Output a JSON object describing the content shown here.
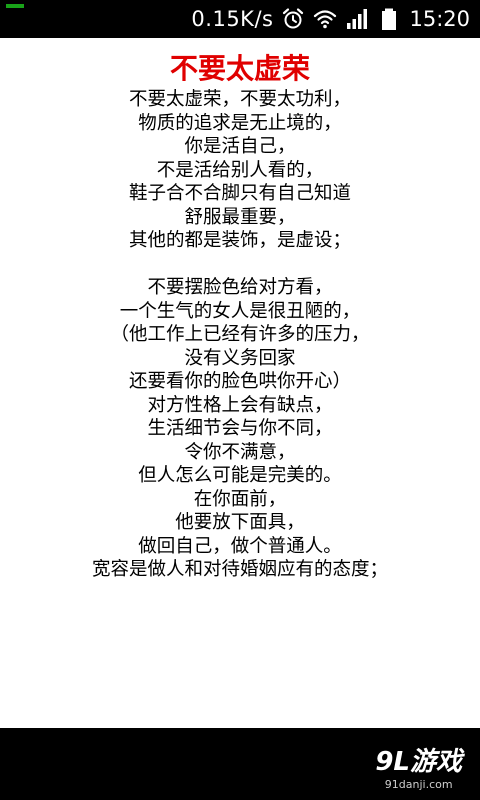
{
  "status_bar": {
    "network_speed": "0.15K/s",
    "time": "15:20",
    "icons": [
      "alarm-icon",
      "wifi-icon",
      "signal-icon",
      "battery-icon"
    ]
  },
  "article": {
    "title": "不要太虚荣",
    "lines": [
      "不要太虚荣，不要太功利，",
      "物质的追求是无止境的，",
      "你是活自己，",
      "不是活给别人看的，",
      "鞋子合不合脚只有自己知道",
      "舒服最重要，",
      "其他的都是装饰，是虚设；",
      "",
      "不要摆脸色给对方看，",
      "一个生气的女人是很丑陋的，",
      "（他工作上已经有许多的压力，",
      "没有义务回家",
      "还要看你的脸色哄你开心）",
      "对方性格上会有缺点，",
      "生活细节会与你不同，",
      "令你不满意，",
      "但人怎么可能是完美的。",
      "在你面前，",
      "他要放下面具，",
      "做回自己，做个普通人。",
      "宽容是做人和对待婚姻应有的态度；"
    ]
  },
  "watermark": {
    "logo_text": "9L游戏",
    "site": "91danji.com"
  },
  "colors": {
    "title": "#e00000",
    "status_indicator": "#19a319",
    "background": "#ffffff",
    "bars": "#000000"
  }
}
